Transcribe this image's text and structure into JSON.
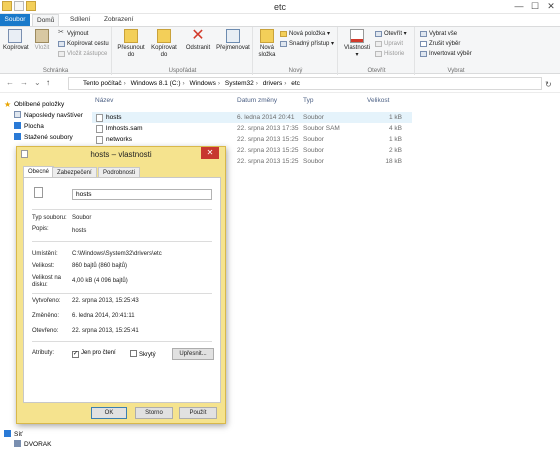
{
  "window": {
    "title": "etc",
    "min": "—",
    "max": "☐",
    "close": "✕"
  },
  "tabs": {
    "file": "Soubor",
    "home": "Domů",
    "share": "Sdílení",
    "view": "Zobrazení"
  },
  "ribbon": {
    "clipboard": {
      "label": "Schránka",
      "copy": "Kopírovat",
      "paste": "Vložit",
      "cut": "Vyjmout",
      "copy_path": "Kopírovat cestu",
      "paste_shortcut": "Vložit zástupce"
    },
    "organize": {
      "label": "Uspořádat",
      "move_to": "Přesunout do",
      "copy_to": "Kopírovat do",
      "delete": "Odstranit",
      "rename": "Přejmenovat"
    },
    "new": {
      "label": "Nový",
      "new_folder": "Nová složka",
      "new_item": "Nová položka",
      "easy_access": "Snadný přístup"
    },
    "open": {
      "label": "Otevřít",
      "properties": "Vlastnosti",
      "open": "Otevřít",
      "edit": "Upravit",
      "history": "Historie"
    },
    "select": {
      "label": "Vybrat",
      "select_all": "Vybrat vše",
      "select_none": "Zrušit výběr",
      "invert": "Invertovat výběr"
    }
  },
  "address": {
    "back": "←",
    "forward": "→",
    "recent": "⌄",
    "up": "↑",
    "crumbs": [
      "Tento počítač",
      "Windows 8.1 (C:)",
      "Windows",
      "System32",
      "drivers",
      "etc"
    ],
    "refresh": "↻"
  },
  "navpane": {
    "favorites": "Oblíbené položky",
    "recent": "Naposledy navštíver",
    "desktop": "Plocha",
    "downloads": "Stažené soubory",
    "network": "Síť",
    "dvorak": "DVORAK"
  },
  "filelist": {
    "columns": {
      "name": "Název",
      "date": "Datum změny",
      "type": "Typ",
      "size": "Velikost"
    },
    "rows": [
      {
        "name": "hosts",
        "date": "6. ledna 2014 20:41",
        "type": "Soubor",
        "size": "1 kB"
      },
      {
        "name": "lmhosts.sam",
        "date": "22. srpna 2013 17:35",
        "type": "Soubor SAM",
        "size": "4 kB"
      },
      {
        "name": "networks",
        "date": "22. srpna 2013 15:25",
        "type": "Soubor",
        "size": "1 kB"
      },
      {
        "name": "",
        "date": "22. srpna 2013 15:25",
        "type": "Soubor",
        "size": "2 kB"
      },
      {
        "name": "",
        "date": "22. srpna 2013 15:25",
        "type": "Soubor",
        "size": "18 kB"
      }
    ]
  },
  "dialog": {
    "title": "hosts – vlastnosti",
    "tabs": [
      "Obecné",
      "Zabezpečení",
      "Podrobnosti"
    ],
    "name": "hosts",
    "labels": {
      "type": "Typ souboru:",
      "opens": "Popis:",
      "location": "Umístění:",
      "size": "Velikost:",
      "disk": "Velikost na disku:",
      "created": "Vytvořeno:",
      "modified": "Změněno:",
      "accessed": "Otevřeno:",
      "attributes": "Atributy:"
    },
    "values": {
      "type": "Soubor",
      "opens": "hosts",
      "location": "C:\\Windows\\System32\\drivers\\etc",
      "size": "860 bajtů (860 bajtů)",
      "disk": "4,00 kB (4 096 bajtů)",
      "created": "22. srpna 2013, 15:25:43",
      "modified": "6. ledna 2014, 20:41:11",
      "accessed": "22. srpna 2013, 15:25:41"
    },
    "readonly": "Jen pro čtení",
    "hidden": "Skrytý",
    "advanced": "Upřesnit...",
    "ok": "OK",
    "cancel": "Storno",
    "apply": "Použít",
    "readonly_checked": "✓"
  }
}
